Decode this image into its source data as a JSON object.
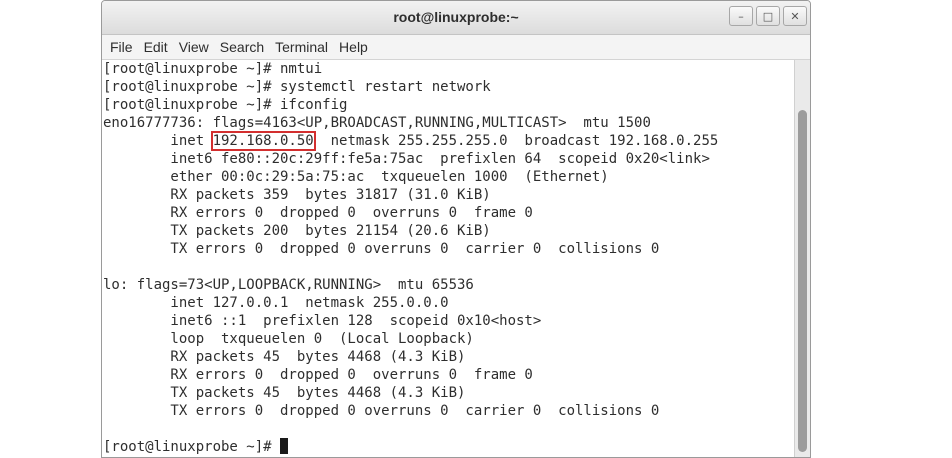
{
  "window": {
    "title": "root@linuxprobe:~",
    "controls": {
      "minimize": "–",
      "maximize": "□",
      "close": "✕"
    }
  },
  "menu": {
    "items": [
      "File",
      "Edit",
      "View",
      "Search",
      "Terminal",
      "Help"
    ]
  },
  "terminal": {
    "lines": [
      "[root@linuxprobe ~]# nmtui",
      "[root@linuxprobe ~]# systemctl restart network",
      "[root@linuxprobe ~]# ifconfig",
      "eno16777736: flags=4163<UP,BROADCAST,RUNNING,MULTICAST>  mtu 1500",
      "",
      "        inet6 fe80::20c:29ff:fe5a:75ac  prefixlen 64  scopeid 0x20<link>",
      "        ether 00:0c:29:5a:75:ac  txqueuelen 1000  (Ethernet)",
      "        RX packets 359  bytes 31817 (31.0 KiB)",
      "        RX errors 0  dropped 0  overruns 0  frame 0",
      "        TX packets 200  bytes 21154 (20.6 KiB)",
      "        TX errors 0  dropped 0 overruns 0  carrier 0  collisions 0",
      "",
      "lo: flags=73<UP,LOOPBACK,RUNNING>  mtu 65536",
      "        inet 127.0.0.1  netmask 255.0.0.0",
      "        inet6 ::1  prefixlen 128  scopeid 0x10<host>",
      "        loop  txqueuelen 0  (Local Loopback)",
      "        RX packets 45  bytes 4468 (4.3 KiB)",
      "        RX errors 0  dropped 0  overruns 0  frame 0",
      "        TX packets 45  bytes 4468 (4.3 KiB)",
      "        TX errors 0  dropped 0 overruns 0  carrier 0  collisions 0",
      "",
      ""
    ],
    "inet_line": {
      "prefix": "        inet ",
      "ip": "192.168.0.50",
      "suffix": "  netmask 255.255.255.0  broadcast 192.168.0.255"
    },
    "prompt": "[root@linuxprobe ~]# ",
    "highlight_color": "#d32f2f"
  }
}
